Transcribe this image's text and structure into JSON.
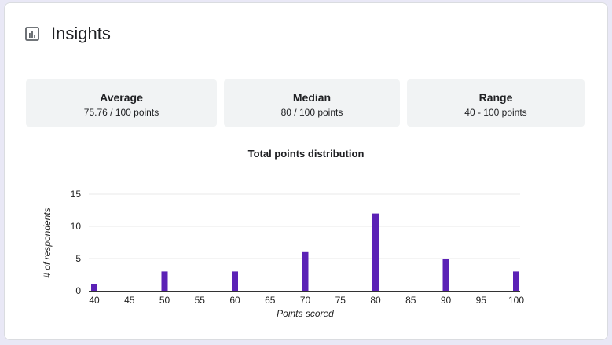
{
  "header": {
    "title": "Insights",
    "icon": "bar-chart-icon"
  },
  "stats": [
    {
      "label": "Average",
      "value": "75.76 / 100 points"
    },
    {
      "label": "Median",
      "value": "80 / 100 points"
    },
    {
      "label": "Range",
      "value": "40 - 100 points"
    }
  ],
  "colors": {
    "bar": "#5b21b6",
    "grid": "#e8e8e8",
    "stat_bg": "#f1f3f4"
  },
  "chart_data": {
    "type": "bar",
    "title": "Total points distribution",
    "xlabel": "Points scored",
    "ylabel": "# of respondents",
    "x_ticks": [
      40,
      45,
      50,
      55,
      60,
      65,
      70,
      75,
      80,
      85,
      90,
      95,
      100
    ],
    "y_ticks": [
      0,
      5,
      10,
      15
    ],
    "xlim": [
      40,
      100
    ],
    "ylim": [
      0,
      15
    ],
    "grid": true,
    "x": [
      40,
      50,
      60,
      70,
      80,
      90,
      100
    ],
    "values": [
      1,
      3,
      3,
      6,
      12,
      5,
      3
    ]
  }
}
